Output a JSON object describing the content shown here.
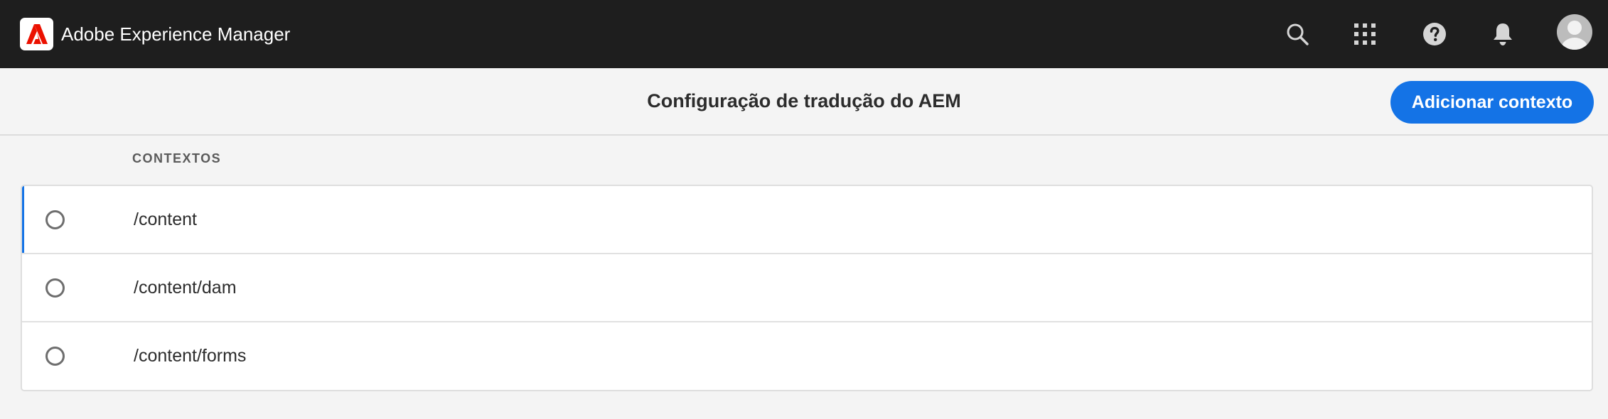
{
  "shell": {
    "app_title": "Adobe Experience Manager",
    "icons": [
      "adobe-logo-icon",
      "search-icon",
      "apps-grid-icon",
      "help-icon",
      "notification-bell-icon",
      "user-avatar-icon"
    ]
  },
  "titlebar": {
    "title": "Configuração de tradução do AEM",
    "add_button_label": "Adicionar contexto"
  },
  "list": {
    "column_header": "CONTEXTOS",
    "rows": [
      {
        "label": "/content",
        "selected": false,
        "focused": true
      },
      {
        "label": "/content/dam",
        "selected": false,
        "focused": false
      },
      {
        "label": "/content/forms",
        "selected": false,
        "focused": false
      }
    ]
  },
  "colors": {
    "shell_bg": "#1e1e1e",
    "accent": "#1473e6",
    "adobe_red": "#eb1000",
    "page_bg": "#f4f4f4"
  }
}
